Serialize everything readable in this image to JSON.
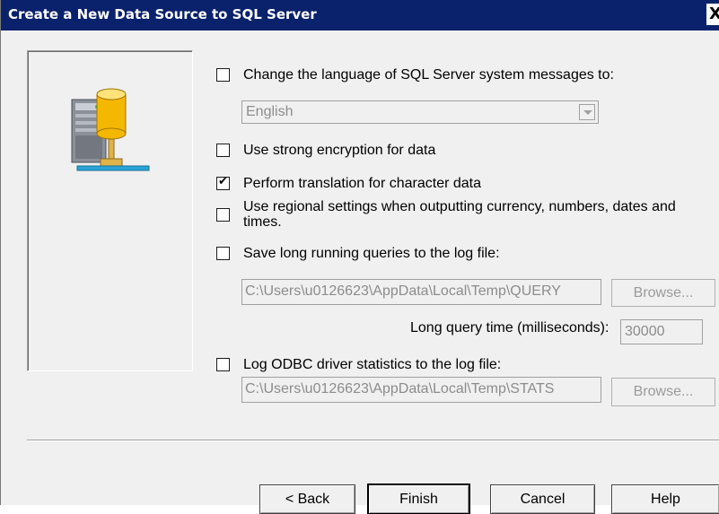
{
  "window": {
    "title": "Create a New Data Source to SQL Server",
    "close_symbol": "X"
  },
  "options": {
    "change_language": {
      "label": "Change the language of SQL Server system messages to:",
      "checked": false
    },
    "language_select": {
      "value": "English"
    },
    "strong_encryption": {
      "label": "Use strong encryption for data",
      "checked": false
    },
    "translation": {
      "label": "Perform translation for character data",
      "checked": true
    },
    "regional": {
      "label_line1": "Use regional settings when outputting currency, numbers, dates and",
      "label_line2": "times.",
      "checked": false
    },
    "long_queries": {
      "label": "Save long running queries to the log file:",
      "checked": false
    },
    "query_log_path": "C:\\Users\\u0126623\\AppData\\Local\\Temp\\QUERY",
    "query_browse_label": "Browse...",
    "long_query_time_label": "Long query time (milliseconds):",
    "long_query_time_value": "30000",
    "driver_stats": {
      "label": "Log ODBC driver statistics to the log file:",
      "checked": false
    },
    "stats_log_path": "C:\\Users\\u0126623\\AppData\\Local\\Temp\\STATS",
    "stats_browse_label": "Browse..."
  },
  "buttons": {
    "back": "< Back",
    "finish": "Finish",
    "cancel": "Cancel",
    "help": "Help"
  },
  "icons": {
    "wizard_image": "database-server-icon",
    "close": "close-icon"
  },
  "colors": {
    "titlebar": "#0a216c",
    "dialog_bg": "#f0f0f0",
    "database_cylinder": "#f5b800"
  }
}
